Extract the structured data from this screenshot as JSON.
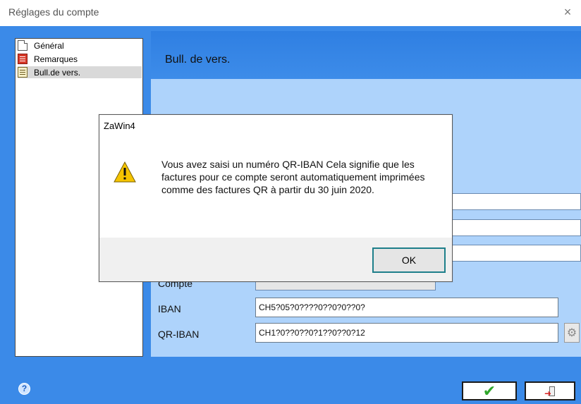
{
  "window": {
    "title": "Réglages du compte",
    "close_glyph": "×"
  },
  "tree": {
    "items": [
      {
        "label": "Général",
        "icon": "page-icon"
      },
      {
        "label": "Remarques",
        "icon": "notes-icon"
      },
      {
        "label": "Bull.de vers.",
        "icon": "payment-slip-icon",
        "selected": true
      }
    ]
  },
  "header": {
    "title": "Bull. de vers."
  },
  "form": {
    "compte_label": "Compte",
    "iban_label": "IBAN",
    "iban_value": "CH5?05?0????0??0?0??0?",
    "qr_iban_label": "QR-IBAN",
    "qr_iban_value": "CH1?0??0??0?1??0??0?12"
  },
  "buttons": {
    "help_glyph": "?",
    "confirm_glyph": "✔"
  },
  "dialog": {
    "title": "ZaWin4",
    "message": "Vous avez saisi un numéro QR-IBAN Cela signifie que les factures pour ce compte seront automatiquement imprimées comme des factures QR à partir du 30 juin 2020.",
    "ok_label": "OK"
  },
  "colors": {
    "window_blue": "#3b8ae8",
    "content_light_blue": "#aed3fb",
    "ok_border": "#1e7f8a",
    "check_green": "#2fa62a",
    "warning_yellow": "#f5c400"
  }
}
